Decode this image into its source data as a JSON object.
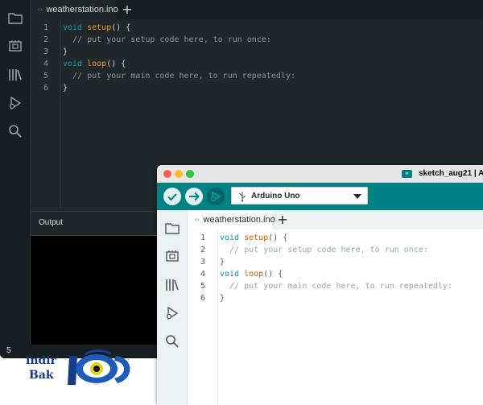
{
  "dark_window": {
    "tab_label": "weatherstation.ino",
    "tab_icon": "‹›",
    "new_tab": "+",
    "output_label": "Output",
    "status_number": "5",
    "sidebar_icons": [
      "folder-icon",
      "board-icon",
      "library-icon",
      "debug-icon",
      "search-icon"
    ],
    "code_lines": [
      {
        "num": "1",
        "indent": "",
        "kw": "void",
        "fn": "setup",
        "rest": "() {",
        "comment": ""
      },
      {
        "num": "2",
        "indent": "  ",
        "kw": "",
        "fn": "",
        "rest": "",
        "comment": "// put your setup code here, to run once:"
      },
      {
        "num": "3",
        "indent": "",
        "kw": "",
        "fn": "",
        "rest": "}",
        "comment": ""
      },
      {
        "num": "4",
        "indent": "",
        "kw": "void",
        "fn": "loop",
        "rest": "() {",
        "comment": ""
      },
      {
        "num": "5",
        "indent": "  ",
        "kw": "",
        "fn": "",
        "rest": "",
        "comment": "// put your main code here, to run repeatedly:"
      },
      {
        "num": "6",
        "indent": "",
        "kw": "",
        "fn": "",
        "rest": "}",
        "comment": ""
      }
    ]
  },
  "light_window": {
    "title": "sketch_aug21 | Ar",
    "title_badge": "∞",
    "board": "Arduino Uno",
    "tab_label": "weatherstation.ino",
    "tab_icon": "‹›",
    "new_tab": "+",
    "toolbar_icons": [
      "verify-icon",
      "upload-icon",
      "debug-icon"
    ],
    "sidebar_icons": [
      "folder-icon",
      "board-icon",
      "library-icon",
      "debug-icon",
      "search-icon"
    ],
    "code_lines": [
      {
        "num": "1",
        "indent": "",
        "kw": "void",
        "fn": "setup",
        "rest": "() {",
        "comment": ""
      },
      {
        "num": "2",
        "indent": "  ",
        "kw": "",
        "fn": "",
        "rest": "",
        "comment": "// put your setup code here, to run once:"
      },
      {
        "num": "3",
        "indent": "",
        "kw": "",
        "fn": "",
        "rest": "}",
        "comment": ""
      },
      {
        "num": "4",
        "indent": "",
        "kw": "void",
        "fn": "loop",
        "rest": "() {",
        "comment": ""
      },
      {
        "num": "5",
        "indent": "  ",
        "kw": "",
        "fn": "",
        "rest": "",
        "comment": "// put your main code here, to run repeatedly:"
      },
      {
        "num": "6",
        "indent": "",
        "kw": "",
        "fn": "",
        "rest": "}",
        "comment": ""
      }
    ]
  },
  "logo": {
    "line1": "indir",
    "line2": "Bak"
  },
  "colors": {
    "arduino_teal": "#008184",
    "dark_bg": "#1f272a",
    "keyword": "#00979d",
    "function": "#d35400"
  }
}
